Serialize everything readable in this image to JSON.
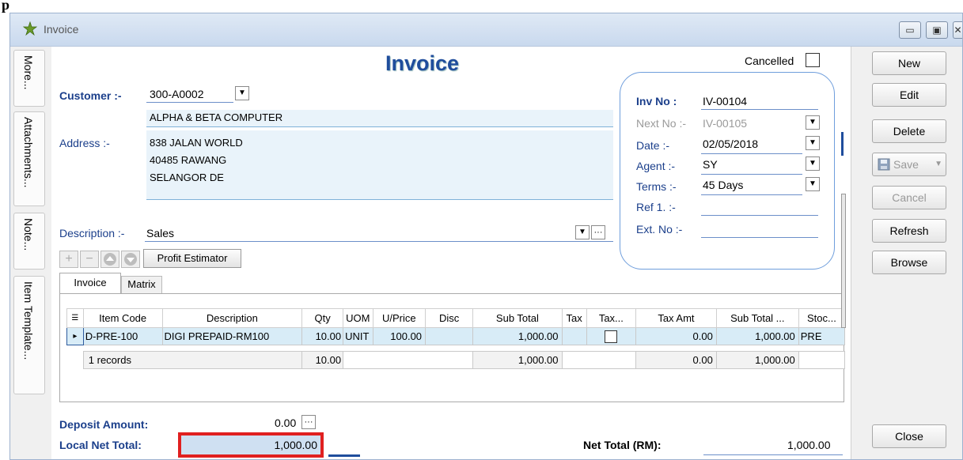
{
  "window": {
    "caption": "Invoice",
    "heading": "Invoice",
    "cancelled_label": "Cancelled",
    "top_caption": "р"
  },
  "side_tabs": [
    "More...",
    "Attachments...",
    "Note...",
    "Item Template..."
  ],
  "customer": {
    "label": "Customer :-",
    "code": "300-A0002",
    "name": "ALPHA & BETA COMPUTER",
    "address_label": "Address :-",
    "address_lines": [
      "838 JALAN WORLD",
      "40485 RAWANG",
      "SELANGOR DE"
    ]
  },
  "description": {
    "label": "Description :-",
    "value": "Sales",
    "more": "···"
  },
  "toolbar": {
    "profit_estimator": "Profit Estimator"
  },
  "tabs": [
    "Invoice",
    "Matrix"
  ],
  "inv_info": {
    "inv_no_label": "Inv No :",
    "inv_no": "IV-00104",
    "next_no_label": "Next No :-",
    "next_no": "IV-00105",
    "date_label": "Date :-",
    "date": "02/05/2018",
    "agent_label": "Agent :-",
    "agent": "SY",
    "terms_label": "Terms :-",
    "terms": "45 Days",
    "ref_label": "Ref 1. :-",
    "ref": "",
    "ext_label": "Ext. No :-",
    "ext": ""
  },
  "grid": {
    "headers": [
      "Item Code",
      "Description",
      "Qty",
      "UOM",
      "U/Price",
      "Disc",
      "Sub Total",
      "Tax",
      "Tax...",
      "Tax Amt",
      "Sub Total ...",
      "Stoc..."
    ],
    "rows": [
      [
        "D-PRE-100",
        "DIGI PREPAID-RM100",
        "10.00",
        "UNIT",
        "100.00",
        "",
        "1,000.00",
        "",
        "",
        "0.00",
        "1,000.00",
        "PRE"
      ]
    ],
    "footer": {
      "records": "1 records",
      "qty": "10.00",
      "sub_total": "1,000.00",
      "tax_amt": "0.00",
      "sub_total2": "1,000.00"
    }
  },
  "totals": {
    "deposit_label": "Deposit Amount:",
    "deposit": "0.00",
    "local_net_label": "Local Net Total:",
    "local_net": "1,000.00",
    "net_total_label": "Net Total (RM):",
    "net_total": "1,000.00"
  },
  "right_buttons": {
    "new": "New",
    "edit": "Edit",
    "delete": "Delete",
    "save": "Save",
    "cancel": "Cancel",
    "refresh": "Refresh",
    "browse": "Browse",
    "close": "Close"
  },
  "colors": {
    "accent_blue": "#1b3f8b",
    "highlight_red": "#e02020",
    "row_selected": "#d8ecf7"
  }
}
